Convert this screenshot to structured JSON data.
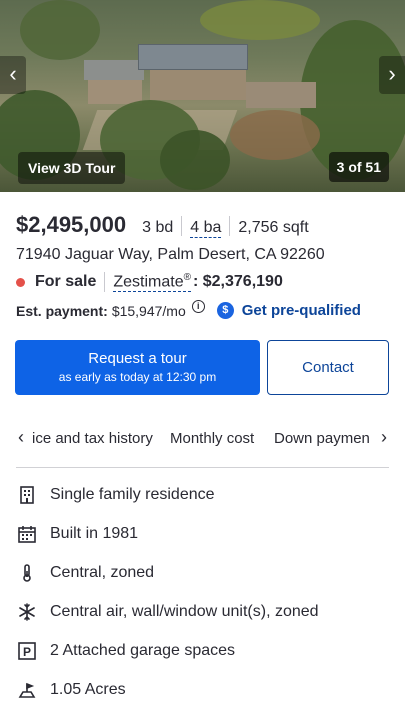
{
  "photo": {
    "tour_label": "View 3D Tour",
    "counter": "3 of 51",
    "prev_icon": "chevron-left-icon",
    "next_icon": "chevron-right-icon"
  },
  "listing": {
    "price": "$2,495,000",
    "beds": "3 bd",
    "baths": "4 ba",
    "sqft": "2,756 sqft",
    "address": "71940 Jaguar Way, Palm Desert, CA 92260",
    "status": "For sale",
    "status_color": "#e4514a",
    "zestimate_label": "Zestimate",
    "zestimate_sup": "®",
    "zestimate_value": ": $2,376,190",
    "payment_label": "Est. payment:",
    "payment_value": "$15,947/mo",
    "prequal_label": "Get pre-qualified"
  },
  "actions": {
    "request_tour": "Request a tour",
    "request_tour_sub": "as early as today at 12:30 pm",
    "contact": "Contact",
    "primary_color": "#0e63e6"
  },
  "tabs": [
    {
      "label": "ice and tax history"
    },
    {
      "label": "Monthly cost"
    },
    {
      "label": "Down paymen"
    }
  ],
  "facts": [
    {
      "label": "Single family residence",
      "icon": "building-icon"
    },
    {
      "label": "Built in 1981",
      "icon": "calendar-icon"
    },
    {
      "label": "Central, zoned",
      "icon": "thermometer-icon"
    },
    {
      "label": "Central air, wall/window unit(s), zoned",
      "icon": "snowflake-icon"
    },
    {
      "label": "2 Attached garage spaces",
      "icon": "parking-icon"
    },
    {
      "label": "1.05 Acres",
      "icon": "lot-size-icon"
    }
  ]
}
